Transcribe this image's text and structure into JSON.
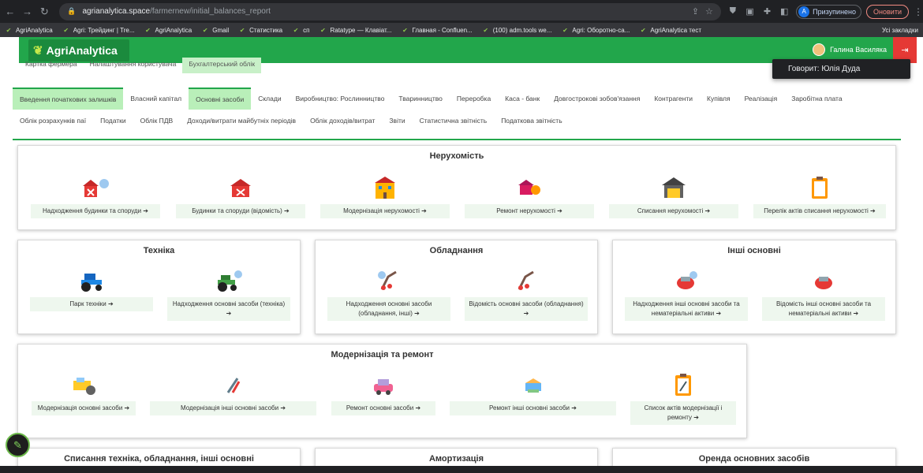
{
  "browser": {
    "url_domain": "agrianalytica.space",
    "url_path": "/farmernew/initial_balances_report",
    "profile_initial": "A",
    "profile_label": "Призупинено",
    "update_label": "Оновити",
    "bookmarks": [
      "AgriAnalytica",
      "Agri: Трейдинг | Tre...",
      "AgriAnalytica",
      "Gmail",
      "Статистика",
      "сп",
      "Ratatype — Клавіат...",
      "Главная - Confluen...",
      "(100) adm.tools we...",
      "Agri: Оборотно-са...",
      "AgriAnalytica тест"
    ],
    "all_bookmarks": "Усі закладки"
  },
  "header": {
    "logo": "AgriAnalytica",
    "user_name": "Галина Василяка",
    "speaker": "Говорит: Юлія Дуда"
  },
  "top_tabs": [
    "Картка фермера",
    "Налаштування користувача",
    "Бухгалтерський облік"
  ],
  "subnav_row1": [
    "Введення початкових залишків",
    "Власний капітал",
    "Основні засоби",
    "Склади",
    "Виробництво: Рослинництво",
    "Тваринництво",
    "Переробка",
    "Каса - банк",
    "Довгострокові зобов'язання",
    "Контрагенти",
    "Купівля",
    "Реалізація",
    "Заробітна плата"
  ],
  "subnav_row2": [
    "Облік розрахунків паї",
    "Податки",
    "Облік ПДВ",
    "Доходи/витрати майбутніх періодів",
    "Облік доходів/витрат",
    "Звіти",
    "Статистична звітність",
    "Податкова звітність"
  ],
  "cards": {
    "realty": {
      "title": "Нерухомість",
      "items": [
        "Надходження будинки та споруди ➔",
        "Будинки та споруди (відомість) ➔",
        "Модернізація нерухомості ➔",
        "Ремонт нерухомості ➔",
        "Списання нерухомості ➔",
        "Перелік актів списання нерухомості ➔"
      ]
    },
    "tech": {
      "title": "Техніка",
      "items": [
        "Парк техніки ➔",
        "Надходження основні засоби (техніка) ➔"
      ]
    },
    "equipment": {
      "title": "Обладнання",
      "items": [
        "Надходження основні засоби (обладнання, інші) ➔",
        "Відомість основні засоби (обладнання) ➔"
      ]
    },
    "other": {
      "title": "Інші основні",
      "items": [
        "Надходження інші основні засоби та нематеріальні активи ➔",
        "Відомість інші основні засоби та нематеріальні активи ➔"
      ]
    },
    "modern": {
      "title": "Модернізація та ремонт",
      "items": [
        "Модернізація основні засоби ➔",
        "Модернізація інші основні засоби ➔",
        "Ремонт основні засоби ➔",
        "Ремонт інші основні засоби ➔",
        "Список актів модернізації і ремонту ➔"
      ]
    },
    "writeoff": {
      "title": "Списання техніка, обладнання, інші основні"
    },
    "amort": {
      "title": "Амортизація"
    },
    "rent": {
      "title": "Оренда основних засобів"
    }
  },
  "colors": {
    "brand_green": "#22a64b",
    "active_tab": "#b9efb9",
    "logout": "#e53935"
  }
}
